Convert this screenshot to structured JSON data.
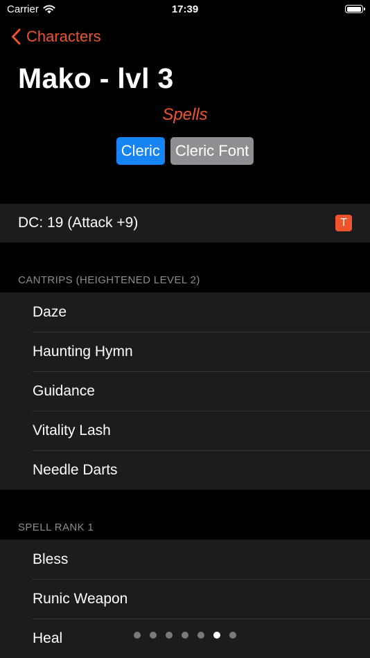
{
  "status_bar": {
    "carrier": "Carrier",
    "time": "17:39",
    "battery_level": 1.0
  },
  "nav": {
    "back_label": "Characters"
  },
  "header": {
    "title": "Mako - lvl 3",
    "subtitle": "Spells"
  },
  "tags": [
    {
      "label": "Cleric",
      "color": "#1784f5"
    },
    {
      "label": "Cleric Font",
      "color": "#8e8e93"
    }
  ],
  "dc_row": {
    "label": "DC: 19 (Attack +9)",
    "badge": "T",
    "badge_color": "#f0542b"
  },
  "sections": [
    {
      "header": "CANTRIPS (HEIGHTENED LEVEL 2)",
      "items": [
        "Daze",
        "Haunting Hymn",
        "Guidance",
        "Vitality Lash",
        "Needle Darts"
      ]
    },
    {
      "header": "SPELL RANK 1",
      "items": [
        "Bless",
        "Runic Weapon",
        "Heal"
      ]
    }
  ],
  "page_indicator": {
    "count": 7,
    "current": 6
  },
  "colors": {
    "accent": "#f0542b",
    "background": "#000000",
    "cell": "#1c1c1e"
  }
}
